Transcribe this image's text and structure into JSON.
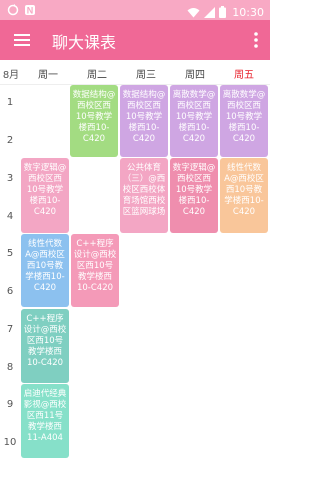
{
  "status": {
    "time": "10:30"
  },
  "app": {
    "title": "聊大课表"
  },
  "header": {
    "month": "8月",
    "days": [
      "周一",
      "周二",
      "周三",
      "周四",
      "周五"
    ],
    "today_index": 4
  },
  "rows": [
    "1",
    "2",
    "3",
    "4",
    "5",
    "6",
    "7",
    "8",
    "9",
    "10"
  ],
  "courses": [
    {
      "id": "c1",
      "col": 1,
      "text": "数据结构@西校区西10号教学楼西10-C420",
      "color": "#a3dc82"
    },
    {
      "id": "c2",
      "col": 2,
      "text": "数据结构@西校区西10号教学楼西10-C420",
      "color": "#cfa6e3"
    },
    {
      "id": "c3",
      "col": 3,
      "text": "离散数学@西校区西10号教学楼西10-C420",
      "color": "#cfa6e3"
    },
    {
      "id": "c4",
      "col": 4,
      "text": "离散数学@西校区西10号教学楼西10-C420",
      "color": "#cfa6e3"
    },
    {
      "id": "c5",
      "col": 0,
      "text": "数字逻辑@西校区西10号教学楼西10-C420",
      "color": "#f3a6c4"
    },
    {
      "id": "c6",
      "col": 2,
      "text": "公共体育（三）@西校区西校体育场馆西校区篮网球场",
      "color": "#f3a6c4"
    },
    {
      "id": "c7",
      "col": 3,
      "text": "数字逻辑@西校区西10号教学楼西10-C420",
      "color": "#ef8eae"
    },
    {
      "id": "c8",
      "col": 4,
      "text": "线性代数A@西校区西10号教学楼西10-C420",
      "color": "#f9c69a"
    },
    {
      "id": "c9",
      "col": 0,
      "text": "线性代数A@西校区西10号教学楼西10-C420",
      "color": "#8cc1ef"
    },
    {
      "id": "c10",
      "col": 1,
      "text": "C++程序设计@西校区西10号教学楼西10-C420",
      "color": "#f49ab8"
    },
    {
      "id": "c11",
      "col": 0,
      "text": "C++程序设计@西校区西10号教学楼西10-C420",
      "color": "#7fcfc1"
    },
    {
      "id": "c12",
      "col": 0,
      "text": "启迪代经典影视@西校区西11号教学楼西11-A404",
      "color": "#86e0c9"
    }
  ]
}
